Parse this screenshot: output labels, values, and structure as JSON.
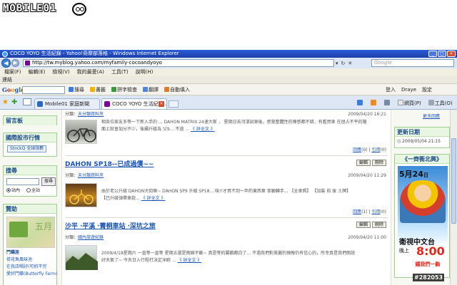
{
  "watermark": {
    "logo": "MOBILE01",
    "photo_id": "#282053"
  },
  "window": {
    "title": "COCO YOYO 生活紀錄 - Yahoo!奇摩部落格 - Windows Internet Explorer"
  },
  "address": {
    "url": "http://tw.myblog.yahoo.com/myfamily-cocoandyoyo",
    "search_placeholder": "Google"
  },
  "menu": [
    "檔案(F)",
    "編輯(E)",
    "檢視(V)",
    "我的最愛(A)",
    "工具(T)",
    "說明(H)"
  ],
  "links_bar": "連結",
  "google_toolbar": {
    "logo": [
      "G",
      "o",
      "o",
      "g",
      "l",
      "e"
    ],
    "tools": [
      "搜尋",
      "書籤",
      "拼字檢查",
      "翻譯",
      "自動填入"
    ],
    "right": [
      "登入",
      "Draye",
      "設定"
    ]
  },
  "tabs": [
    {
      "label": "Mobile01 家庭新聞",
      "color": "#2a66c2"
    },
    {
      "label": "COCO YOYO 生活紀錄...",
      "color": "#7b0099"
    }
  ],
  "command_bar": [
    "網頁(P)",
    "工具(O)"
  ],
  "left": {
    "w1": "留言板",
    "w2": {
      "title": "國際股市行情",
      "button": "StockQ 全球指數"
    },
    "w3": {
      "title": "搜尋",
      "button": "搜尋",
      "opt1": "站內",
      "opt2": "全站"
    },
    "w4": {
      "title": "贊助",
      "img_text": "五月",
      "line1": "鬥蝶居",
      "caption1": "荷花魚風味池",
      "caption2": "在我店喝好(可抓不完",
      "caption3": "愛好鬥蝶(Butterfly Farm)"
    }
  },
  "posts": [
    {
      "category_label": "分類：",
      "category": "未分類資料夾",
      "time": "2009/04/20 16:21",
      "excerpt1": "相各位家友多等一下新入手的 ... DAHON MATRIX 24速大斯 ， 星期日去河濱試車後，感覺整體性的陣感都不錯，有看買車 在旭占不平的路",
      "excerpt2": "面上就會加分不少，後續升級為 父9... 不過 ...",
      "more": "《 詳全文 》",
      "reply": "回應",
      "reply_count": "(0)",
      "cite": "引用",
      "cite_count": "(0)"
    },
    {
      "title": "DAHON SP18--已成過債~~",
      "btn1": "編輯",
      "btn2": "刪除",
      "category_label": "分類：",
      "category": "未分類資料夾",
      "time": "2009/04/20 11:29",
      "excerpt1": "由於老公升級 DAHON大街嘛~ DAHON SP9 升級 SP18... 唉!!才買不到一年的東西車 寧願轉手... 【全車照】 【加裝 前 後 土牌】",
      "excerpt2": "【已升級領帶車款...",
      "more": "《 詳全文 》",
      "reply": "回應",
      "reply_count": "(1)",
      "cite": "引用",
      "cite_count": "(0)"
    },
    {
      "title": "沙平 ‧平溪 ‧菁桐車站 ‧深坑之旅",
      "btn1": "編輯",
      "btn2": "刪除",
      "category_label": "分類：",
      "category": "國內旅遊紀錄",
      "time": "2009/04/20 11:00",
      "excerpt1": "2009/4/18星期六 一直等一直等 星期五還是雨綿不斷~ 真是等的腸餓都白了... 不過我們對美麗的預報仍有信心的，所幸真是我們剛說",
      "excerpt2": "好天氣了~ 今天日入行程打決定沖跑 ...",
      "more": "《 詳全文 》"
    }
  ],
  "right": {
    "more_link": "更多回應",
    "update_title": "更新日期",
    "update_time": "2009/05/04 21:15",
    "ad_title": "《一齊衝北興》",
    "ad_date": "5月24",
    "ad_day": "日",
    "ad_channel": "衛視中文台",
    "ad_night": "晚上",
    "ad_time": "8:00",
    "ad_slogan": "鐵我們一齣"
  }
}
